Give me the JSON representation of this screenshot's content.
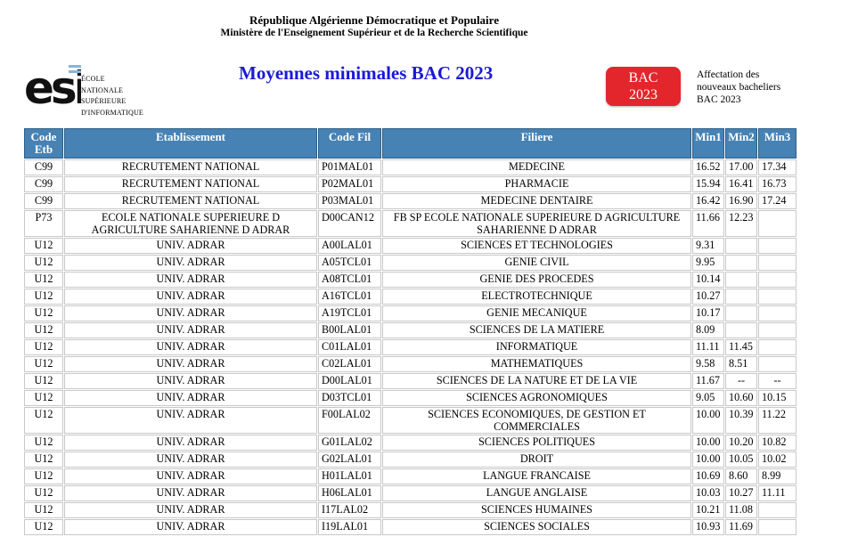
{
  "header": {
    "line1": "République Algérienne Démocratique et Populaire",
    "line2": "Ministère de l'Enseignement Supérieur et de la Recherche Scientifique",
    "title": "Moyennes minimales BAC 2023"
  },
  "logo": {
    "mark": "esi",
    "line1": "ÉCOLE NATIONALE",
    "line2": "SUPÉRIEURE",
    "line3": "D'INFORMATIQUE"
  },
  "badge": {
    "line1": "BAC",
    "line2": "2023",
    "color": "#e2262b"
  },
  "side_note": {
    "line1": "Affectation des",
    "line2": "nouveaux bacheliers",
    "line3": "BAC 2023"
  },
  "table": {
    "header_color": "#4682b4",
    "columns": [
      "Code Etb",
      "Etablissement",
      "Code Fil",
      "Filiere",
      "Min1",
      "Min2",
      "Min3"
    ],
    "rows": [
      [
        "C99",
        "RECRUTEMENT NATIONAL",
        "P01MAL01",
        "MEDECINE",
        "16.52",
        "17.00",
        "17.34"
      ],
      [
        "C99",
        "RECRUTEMENT NATIONAL",
        "P02MAL01",
        "PHARMACIE",
        "15.94",
        "16.41",
        "16.73"
      ],
      [
        "C99",
        "RECRUTEMENT NATIONAL",
        "P03MAL01",
        "MEDECINE DENTAIRE",
        "16.42",
        "16.90",
        "17.24"
      ],
      [
        "P73",
        "ECOLE NATIONALE SUPERIEURE D AGRICULTURE SAHARIENNE D ADRAR",
        "D00CAN12",
        "FB SP ECOLE NATIONALE SUPERIEURE D AGRICULTURE SAHARIENNE D ADRAR",
        "11.66",
        "12.23",
        ""
      ],
      [
        "U12",
        "UNIV. ADRAR",
        "A00LAL01",
        "SCIENCES ET TECHNOLOGIES",
        "9.31",
        "",
        ""
      ],
      [
        "U12",
        "UNIV. ADRAR",
        "A05TCL01",
        "GENIE CIVIL",
        "9.95",
        "",
        ""
      ],
      [
        "U12",
        "UNIV. ADRAR",
        "A08TCL01",
        "GENIE DES PROCEDES",
        "10.14",
        "",
        ""
      ],
      [
        "U12",
        "UNIV. ADRAR",
        "A16TCL01",
        "ELECTROTECHNIQUE",
        "10.27",
        "",
        ""
      ],
      [
        "U12",
        "UNIV. ADRAR",
        "A19TCL01",
        "GENIE MECANIQUE",
        "10.17",
        "",
        ""
      ],
      [
        "U12",
        "UNIV. ADRAR",
        "B00LAL01",
        "SCIENCES DE LA MATIERE",
        "8.09",
        "",
        ""
      ],
      [
        "U12",
        "UNIV. ADRAR",
        "C01LAL01",
        "INFORMATIQUE",
        "11.11",
        "11.45",
        ""
      ],
      [
        "U12",
        "UNIV. ADRAR",
        "C02LAL01",
        "MATHEMATIQUES",
        "9.58",
        "8.51",
        ""
      ],
      [
        "U12",
        "UNIV. ADRAR",
        "D00LAL01",
        "SCIENCES DE LA NATURE ET DE LA VIE",
        "11.67",
        "--",
        "--"
      ],
      [
        "U12",
        "UNIV. ADRAR",
        "D03TCL01",
        "SCIENCES AGRONOMIQUES",
        "9.05",
        "10.60",
        "10.15"
      ],
      [
        "U12",
        "UNIV. ADRAR",
        "F00LAL02",
        "SCIENCES ECONOMIQUES, DE GESTION ET COMMERCIALES",
        "10.00",
        "10.39",
        "11.22"
      ],
      [
        "U12",
        "UNIV. ADRAR",
        "G01LAL02",
        "SCIENCES POLITIQUES",
        "10.00",
        "10.20",
        "10.82"
      ],
      [
        "U12",
        "UNIV. ADRAR",
        "G02LAL01",
        "DROIT",
        "10.00",
        "10.05",
        "10.02"
      ],
      [
        "U12",
        "UNIV. ADRAR",
        "H01LAL01",
        "LANGUE FRANCAISE",
        "10.69",
        "8.60",
        "8.99"
      ],
      [
        "U12",
        "UNIV. ADRAR",
        "H06LAL01",
        "LANGUE ANGLAISE",
        "10.03",
        "10.27",
        "11.11"
      ],
      [
        "U12",
        "UNIV. ADRAR",
        "I17LAL02",
        "SCIENCES HUMAINES",
        "10.21",
        "11.08",
        ""
      ],
      [
        "U12",
        "UNIV. ADRAR",
        "I19LAL01",
        "SCIENCES SOCIALES",
        "10.93",
        "11.69",
        ""
      ]
    ]
  }
}
